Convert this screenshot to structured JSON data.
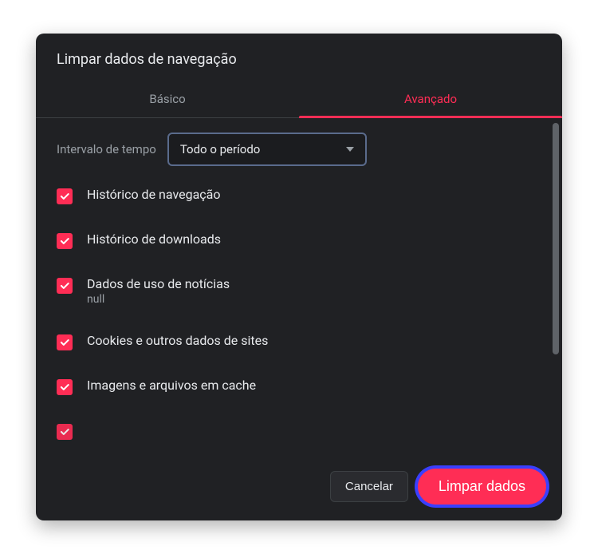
{
  "dialog": {
    "title": "Limpar dados de navegação"
  },
  "tabs": {
    "basic": "Básico",
    "advanced": "Avançado"
  },
  "timeRange": {
    "label": "Intervalo de tempo",
    "value": "Todo o período"
  },
  "options": [
    {
      "label": "Histórico de navegação",
      "sub": ""
    },
    {
      "label": "Histórico de downloads",
      "sub": ""
    },
    {
      "label": "Dados de uso de notícias",
      "sub": "null"
    },
    {
      "label": "Cookies e outros dados de sites",
      "sub": ""
    },
    {
      "label": "Imagens e arquivos em cache",
      "sub": ""
    }
  ],
  "footer": {
    "cancel": "Cancelar",
    "clear": "Limpar dados"
  },
  "colors": {
    "accent": "#ff2d55",
    "focusRing": "#3a3fff",
    "bg": "#202124"
  }
}
